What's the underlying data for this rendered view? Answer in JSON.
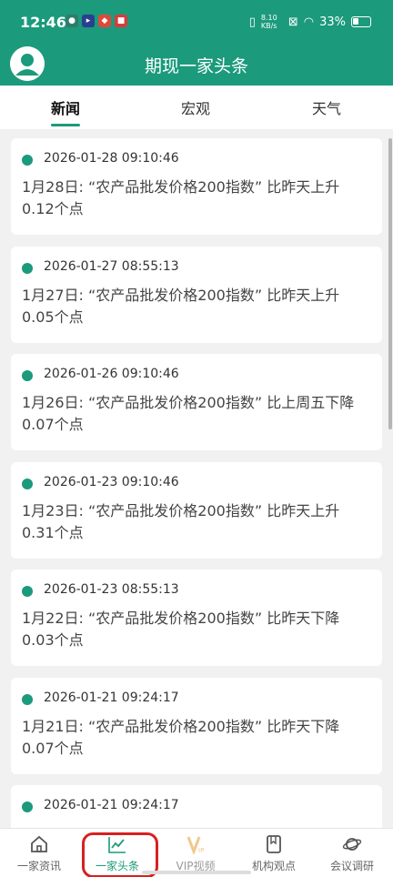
{
  "status": {
    "time": "12:46",
    "mini_icons": [
      "app-icon-1",
      "app-icon-2",
      "app-icon-3",
      "app-icon-4"
    ],
    "net_speed": "8.10 KB/s",
    "battery": "33%"
  },
  "header": {
    "title": "期现一家头条"
  },
  "tabs": [
    {
      "label": "新闻",
      "active": true
    },
    {
      "label": "宏观",
      "active": false
    },
    {
      "label": "天气",
      "active": false
    }
  ],
  "news": [
    {
      "time": "2026-01-28 09:10:46",
      "text": "1月28日: “农产品批发价格200指数” 比昨天上升0.12个点"
    },
    {
      "time": "2026-01-27 08:55:13",
      "text": "1月27日: “农产品批发价格200指数” 比昨天上升0.05个点"
    },
    {
      "time": "2026-01-26 09:10:46",
      "text": "1月26日: “农产品批发价格200指数” 比上周五下降0.07个点"
    },
    {
      "time": "2026-01-23 09:10:46",
      "text": "1月23日: “农产品批发价格200指数” 比昨天上升0.31个点"
    },
    {
      "time": "2026-01-23 08:55:13",
      "text": "1月22日: “农产品批发价格200指数” 比昨天下降0.03个点"
    },
    {
      "time": "2026-01-21 09:24:17",
      "text": "1月21日: “农产品批发价格200指数” 比昨天下降0.07个点"
    },
    {
      "time": "2026-01-21 09:24:17",
      "text": ""
    }
  ],
  "bottom_nav": [
    {
      "label": "一家资讯",
      "icon": "home-icon"
    },
    {
      "label": "一家头条",
      "icon": "chart-icon",
      "active": true
    },
    {
      "label": "VIP视频",
      "icon": "vip-icon"
    },
    {
      "label": "机构观点",
      "icon": "book-icon"
    },
    {
      "label": "会议调研",
      "icon": "planet-icon"
    }
  ],
  "colors": {
    "primary": "#1b9a7c",
    "highlight": "#d82020"
  }
}
